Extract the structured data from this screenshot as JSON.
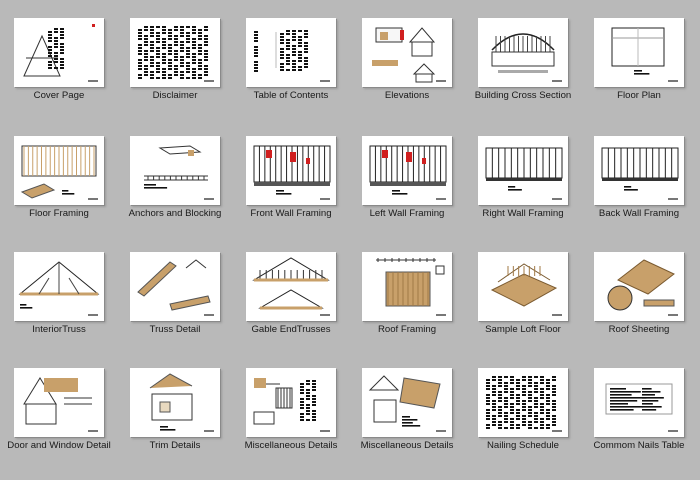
{
  "pages": [
    {
      "label": "Cover Page",
      "art": "cover"
    },
    {
      "label": "Disclaimer",
      "art": "text"
    },
    {
      "label": "Table of Contents",
      "art": "toc"
    },
    {
      "label": "Elevations",
      "art": "elev"
    },
    {
      "label": "Building Cross Section",
      "art": "cross"
    },
    {
      "label": "Floor Plan",
      "art": "plan"
    },
    {
      "label": "Floor Framing",
      "art": "floorframe"
    },
    {
      "label": "Anchors and Blocking",
      "art": "anchors"
    },
    {
      "label": "Front Wall Framing",
      "art": "wallred"
    },
    {
      "label": "Left Wall Framing",
      "art": "wallred"
    },
    {
      "label": "Right Wall Framing",
      "art": "wall"
    },
    {
      "label": "Back Wall Framing",
      "art": "wall"
    },
    {
      "label": "InteriorTruss",
      "art": "truss"
    },
    {
      "label": "Truss Detail",
      "art": "trussdetail"
    },
    {
      "label": "Gable EndTrusses",
      "art": "gable"
    },
    {
      "label": "Roof Framing",
      "art": "roofframe"
    },
    {
      "label": "Sample Loft Floor",
      "art": "loft"
    },
    {
      "label": "Roof Sheeting",
      "art": "sheeting"
    },
    {
      "label": "Door and Window Detail",
      "art": "door"
    },
    {
      "label": "Trim Details",
      "art": "trim"
    },
    {
      "label": "Miscellaneous Details",
      "art": "misc"
    },
    {
      "label": "Miscellaneous Details",
      "art": "misc2"
    },
    {
      "label": "Nailing Schedule",
      "art": "text"
    },
    {
      "label": "Commom Nails Table",
      "art": "nails"
    }
  ],
  "colors": {
    "background": "#b9b9b9",
    "page": "#ffffff",
    "wood": "#c8a06a",
    "accent": "#d01f1f"
  }
}
